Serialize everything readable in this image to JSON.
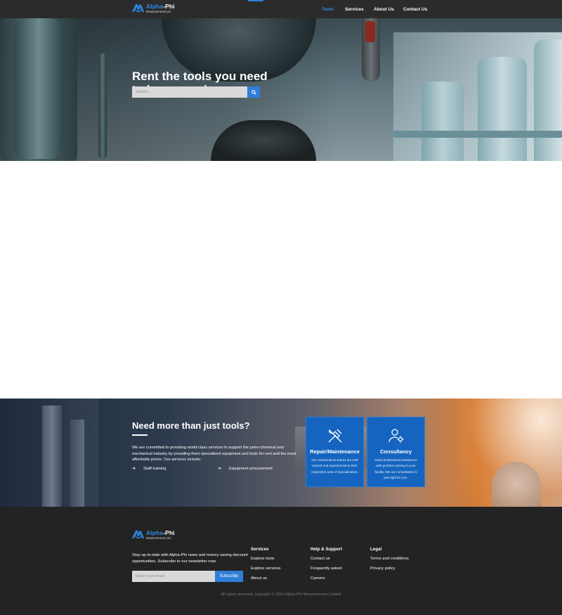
{
  "brand": {
    "name_part1": "Alpha",
    "name_part2": "-Phi",
    "tagline": "Measurements Ltd."
  },
  "nav": [
    {
      "label": "Tools",
      "active": true
    },
    {
      "label": "Services",
      "active": false
    },
    {
      "label": "About Us",
      "active": false
    },
    {
      "label": "Contact Us",
      "active": false
    }
  ],
  "hero": {
    "title_line1": "Rent the tools you need",
    "title_line2": "to keep running",
    "search_placeholder": "Search...",
    "search_icon": "search-icon"
  },
  "services_band": {
    "title": "Need more than just tools?",
    "text": "We are committed to providing world-class services to support the petro-chemical and mechanical industry by providing them specialized equipment and tools for rent and the most affordable prices. Our services include:",
    "items": [
      "Staff training",
      "Equipment procurement"
    ],
    "cards": [
      {
        "icon": "tools-icon",
        "title": "Repair/Maintenance",
        "text": "Our maintenance teams are well trained and experienced in their respective area of specialization."
      },
      {
        "icon": "consultant-gear-icon",
        "title": "Consultancy",
        "text": "Need professional assistance with problem solving in your facility. We our consultation is just right for you."
      }
    ]
  },
  "footer": {
    "newsletter_text": "Stay up-to-date with Alpha-Phi news and money saving discount opportunities. Subscribe to our newsletter now.",
    "email_placeholder": "Enter your email",
    "subscribe_label": "Subscribe",
    "columns": [
      {
        "heading": "Services",
        "links": [
          "Explore tools",
          "Explore services",
          "About us"
        ]
      },
      {
        "heading": "Help & Support",
        "links": [
          "Contact us",
          "Frequently asked",
          "Careers"
        ]
      },
      {
        "heading": "Legal",
        "links": [
          "Terms and conditions",
          "Privacy policy"
        ]
      }
    ],
    "copyright": "All rights reserved, copyright © 2023 Alpha-Phi Measurement Limited"
  },
  "colors": {
    "accent": "#2f7fd8",
    "nav_bg": "#2b2b2b",
    "footer_bg": "#232323",
    "card_bg": "#1565c0"
  }
}
